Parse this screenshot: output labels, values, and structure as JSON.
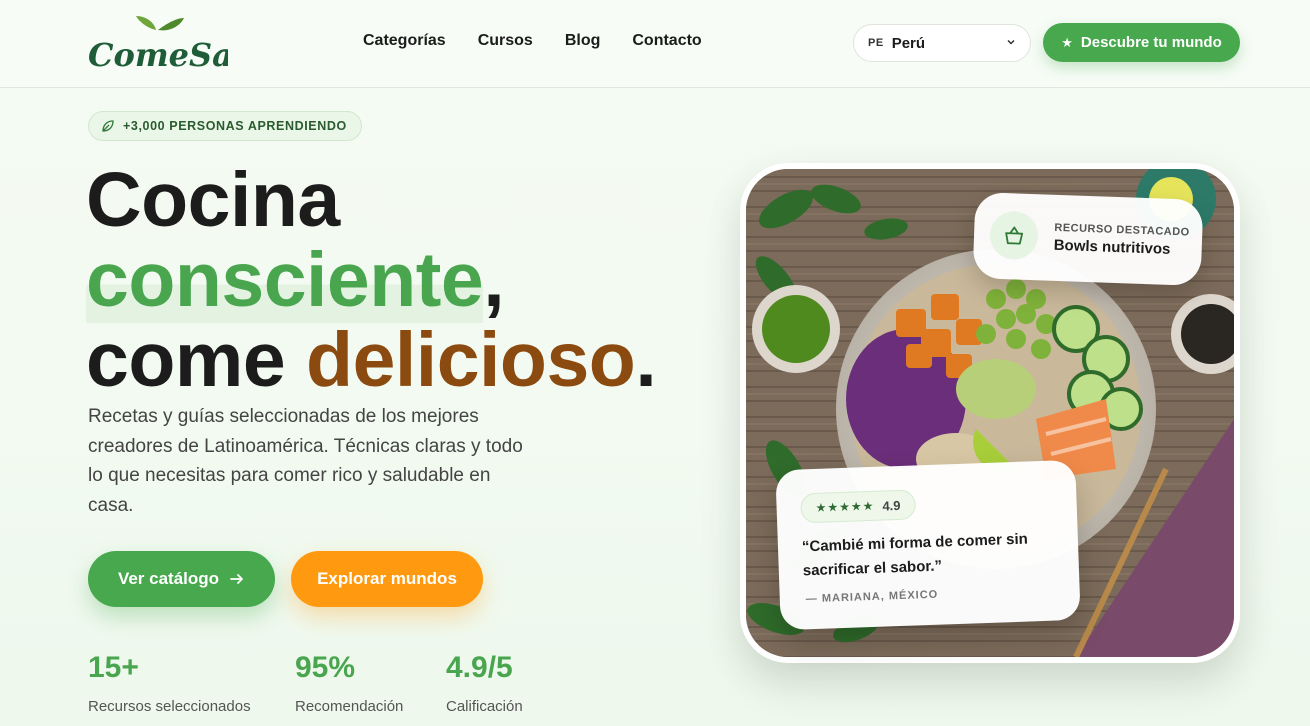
{
  "brand": {
    "logo_text": "ComeSano"
  },
  "nav": {
    "items": [
      "Categorías",
      "Cursos",
      "Blog",
      "Contacto"
    ]
  },
  "country_select": {
    "code": "PE",
    "value": "Perú"
  },
  "header_cta": {
    "label": "Descubre tu mundo"
  },
  "badge": {
    "label": "+3,000 PERSONAS APRENDIENDO"
  },
  "headline": {
    "line1": "Cocina",
    "line2_highlight": "consciente",
    "line2_suffix": ",",
    "line3_prefix": "come ",
    "line3_highlight": "delicioso",
    "line3_suffix": "."
  },
  "description": "Recetas y guías seleccionadas de los mejores creadores de Latinoamérica. Técnicas claras y todo lo que necesitas para comer rico y saludable en casa.",
  "buttons": {
    "primary": "Ver catálogo",
    "secondary": "Explorar mundos"
  },
  "stats": [
    {
      "value": "15+",
      "label": "Recursos seleccionados"
    },
    {
      "value": "95%",
      "label": "Recomendación"
    },
    {
      "value": "4.9/5",
      "label": "Calificación"
    }
  ],
  "featured_card": {
    "kicker": "RECURSO DESTACADO",
    "title": "Bowls nutritivos"
  },
  "review_card": {
    "stars": "★★★★★",
    "rating": "4.9",
    "quote": "“Cambié mi forma de comer sin sacrificar el sabor.”",
    "author": "— MARIANA, MÉXICO"
  },
  "colors": {
    "brand_green": "#47a84e",
    "accent_orange": "#ff9a10",
    "accent_brown": "#8b4a0f"
  }
}
